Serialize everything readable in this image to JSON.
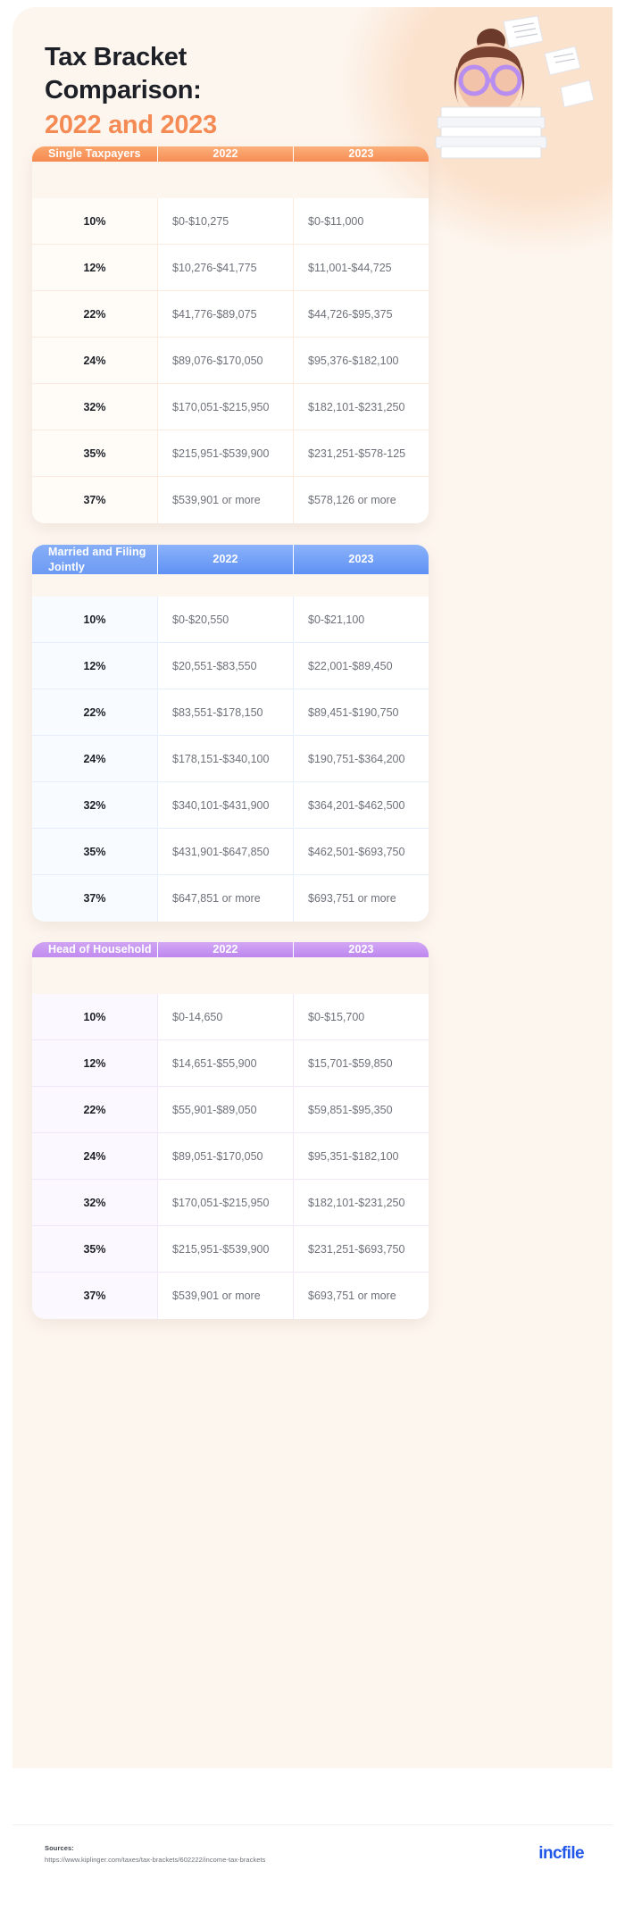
{
  "header": {
    "title_line1": "Tax Bracket",
    "title_line2": "Comparison:",
    "title_accent": "2022 and 2023",
    "accent_color": "#f58b54"
  },
  "illustration": {
    "name": "woman-with-paperwork-illustration",
    "alt": "3D character with glasses behind a stack of papers"
  },
  "tables": [
    {
      "id": "single-taxpayers",
      "theme": "orange",
      "accent_color": "#f68d55",
      "headers": [
        "Single Taxpayers",
        "2022",
        "2023"
      ],
      "rows": [
        {
          "rate": "10%",
          "y2022": "$0-$10,275",
          "y2023": "$0-$11,000"
        },
        {
          "rate": "12%",
          "y2022": "$10,276-$41,775",
          "y2023": "$11,001-$44,725"
        },
        {
          "rate": "22%",
          "y2022": "$41,776-$89,075",
          "y2023": "$44,726-$95,375"
        },
        {
          "rate": "24%",
          "y2022": "$89,076-$170,050",
          "y2023": "$95,376-$182,100"
        },
        {
          "rate": "32%",
          "y2022": "$170,051-$215,950",
          "y2023": "$182,101-$231,250"
        },
        {
          "rate": "35%",
          "y2022": "$215,951-$539,900",
          "y2023": "$231,251-$578-125"
        },
        {
          "rate": "37%",
          "y2022": "$539,901 or more",
          "y2023": "$578,126 or more"
        }
      ]
    },
    {
      "id": "married-filing-jointly",
      "theme": "blue",
      "accent_color": "#5e91f5",
      "headers": [
        "Married and Filing Jointly",
        "2022",
        "2023"
      ],
      "rows": [
        {
          "rate": "10%",
          "y2022": "$0-$20,550",
          "y2023": "$0-$21,100"
        },
        {
          "rate": "12%",
          "y2022": "$20,551-$83,550",
          "y2023": "$22,001-$89,450"
        },
        {
          "rate": "22%",
          "y2022": "$83,551-$178,150",
          "y2023": "$89,451-$190,750"
        },
        {
          "rate": "24%",
          "y2022": "$178,151-$340,100",
          "y2023": "$190,751-$364,200"
        },
        {
          "rate": "32%",
          "y2022": "$340,101-$431,900",
          "y2023": "$364,201-$462,500"
        },
        {
          "rate": "35%",
          "y2022": "$431,901-$647,850",
          "y2023": "$462,501-$693,750"
        },
        {
          "rate": "37%",
          "y2022": "$647,851 or more",
          "y2023": "$693,751 or more"
        }
      ]
    },
    {
      "id": "head-of-household",
      "theme": "purple",
      "accent_color": "#bd86ee",
      "headers": [
        "Head of Household",
        "2022",
        "2023"
      ],
      "rows": [
        {
          "rate": "10%",
          "y2022": "$0-14,650",
          "y2023": "$0-$15,700"
        },
        {
          "rate": "12%",
          "y2022": "$14,651-$55,900",
          "y2023": "$15,701-$59,850"
        },
        {
          "rate": "22%",
          "y2022": "$55,901-$89,050",
          "y2023": "$59,851-$95,350"
        },
        {
          "rate": "24%",
          "y2022": "$89,051-$170,050",
          "y2023": "$95,351-$182,100"
        },
        {
          "rate": "32%",
          "y2022": "$170,051-$215,950",
          "y2023": "$182,101-$231,250"
        },
        {
          "rate": "35%",
          "y2022": "$215,951-$539,900",
          "y2023": "$231,251-$693,750"
        },
        {
          "rate": "37%",
          "y2022": "$539,901 or more",
          "y2023": "$693,751 or more"
        }
      ]
    }
  ],
  "footer": {
    "sources_label": "Sources:",
    "sources_url": "https://www.kiplinger.com/taxes/tax-brackets/602222/income-tax-brackets",
    "brand": "incfile",
    "brand_color": "#2157e8"
  }
}
